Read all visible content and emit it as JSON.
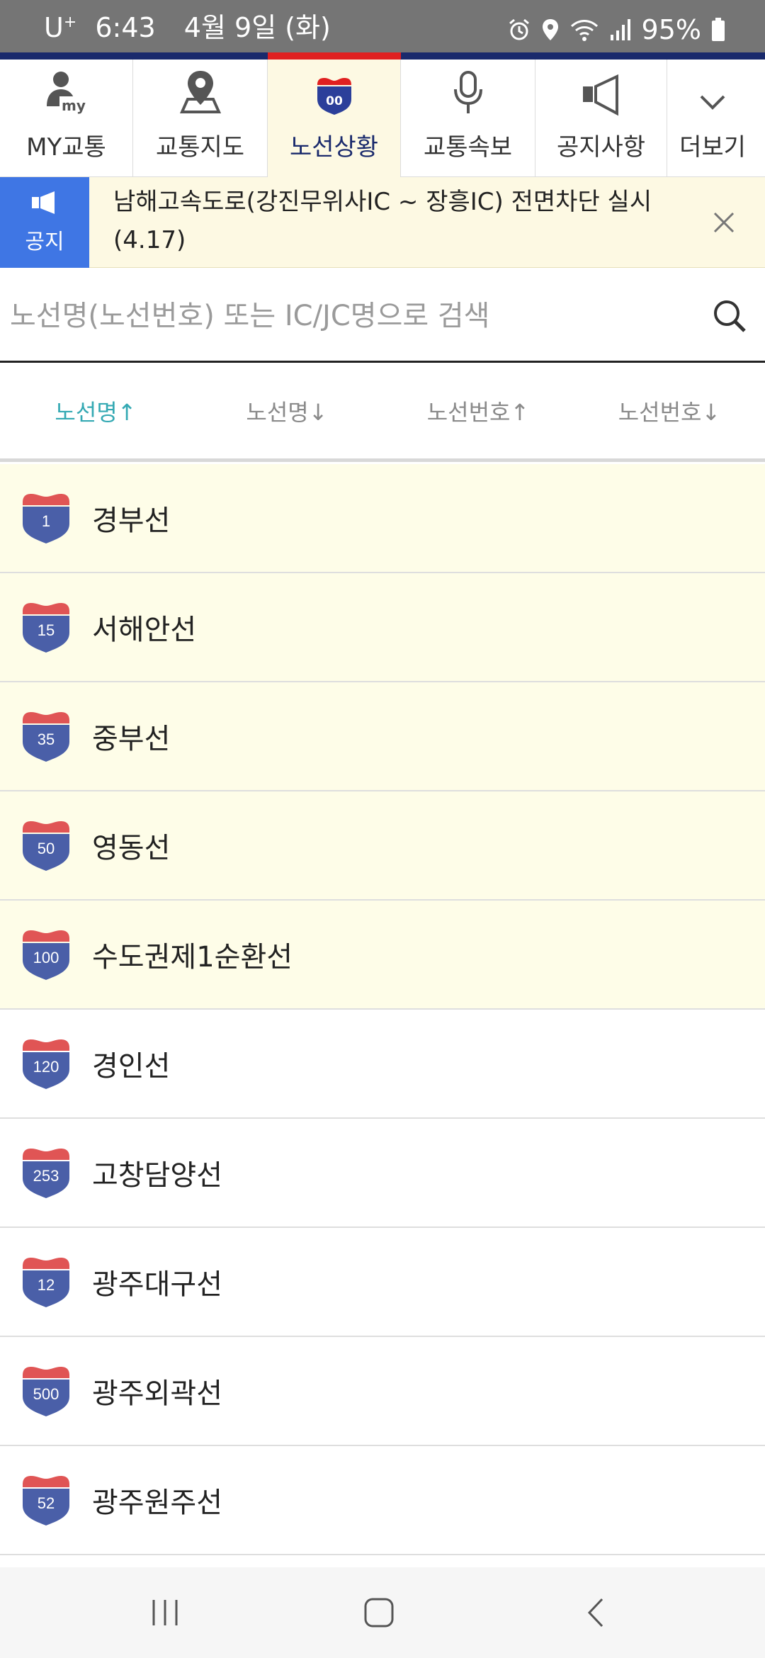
{
  "status_bar": {
    "carrier": "U",
    "carrier_sup": "+",
    "time": "6:43",
    "date": "4월 9일 (화)",
    "battery": "95%"
  },
  "nav": {
    "items": [
      {
        "label": "MY교통",
        "icon": "my-traffic-person-icon"
      },
      {
        "label": "교통지도",
        "icon": "map-pin-icon"
      },
      {
        "label": "노선상황",
        "icon": "route-shield-icon"
      },
      {
        "label": "교통속보",
        "icon": "microphone-icon"
      },
      {
        "label": "공지사항",
        "icon": "megaphone-icon"
      },
      {
        "label": "더보기",
        "icon": "chevron-down-icon"
      }
    ],
    "active_index": 2
  },
  "notice": {
    "badge_label": "공지",
    "text": "남해고속도로(강진무위사IC ~ 장흥IC) 전면차단 실시(4.17)"
  },
  "search": {
    "placeholder": "노선명(노선번호) 또는 IC/JC명으로 검색",
    "value": ""
  },
  "sort_tabs": [
    {
      "label": "노선명↑",
      "active": true
    },
    {
      "label": "노선명↓",
      "active": false
    },
    {
      "label": "노선번호↑",
      "active": false
    },
    {
      "label": "노선번호↓",
      "active": false
    }
  ],
  "routes": [
    {
      "number": "1",
      "name": "경부선",
      "highlighted": true
    },
    {
      "number": "15",
      "name": "서해안선",
      "highlighted": true
    },
    {
      "number": "35",
      "name": "중부선",
      "highlighted": true
    },
    {
      "number": "50",
      "name": "영동선",
      "highlighted": true
    },
    {
      "number": "100",
      "name": "수도권제1순환선",
      "highlighted": true
    },
    {
      "number": "120",
      "name": "경인선",
      "highlighted": false
    },
    {
      "number": "253",
      "name": "고창담양선",
      "highlighted": false
    },
    {
      "number": "12",
      "name": "광주대구선",
      "highlighted": false
    },
    {
      "number": "500",
      "name": "광주외곽선",
      "highlighted": false
    },
    {
      "number": "52",
      "name": "광주원주선",
      "highlighted": false
    }
  ],
  "colors": {
    "accent_navy": "#1a2a6c",
    "accent_red": "#e02020",
    "notice_blue": "#3f76e4",
    "sort_active_teal": "#34a9b3",
    "highlight_bg": "#fefde8",
    "shield_blue": "#4a5fa8",
    "shield_red": "#e05555"
  }
}
